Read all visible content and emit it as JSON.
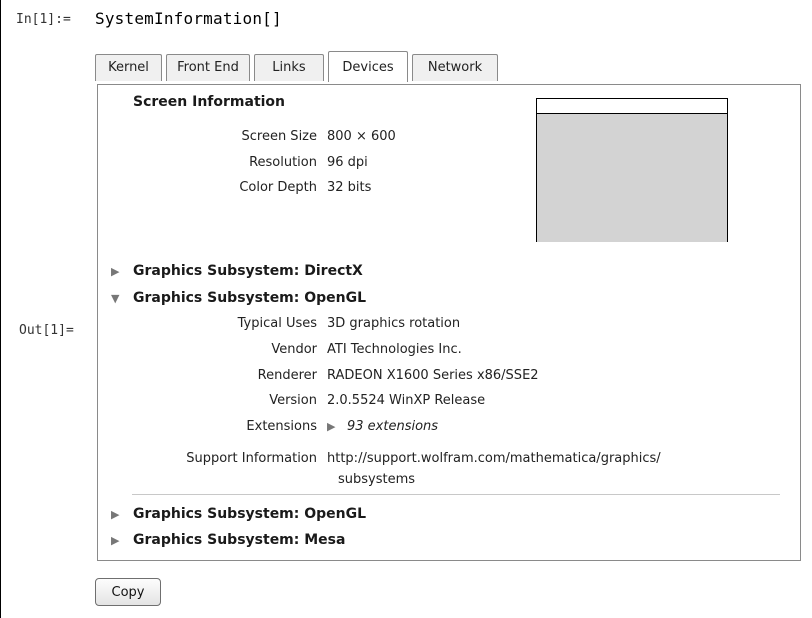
{
  "cell": {
    "in_label": "In[1]:=",
    "input": "SystemInformation[]",
    "out_label": "Out[1]="
  },
  "tabs": [
    {
      "label": "Kernel",
      "active": false
    },
    {
      "label": "Front End",
      "active": false
    },
    {
      "label": "Links",
      "active": false
    },
    {
      "label": "Devices",
      "active": true
    },
    {
      "label": "Network",
      "active": false
    }
  ],
  "screen": {
    "title": "Screen Information",
    "rows": [
      {
        "label": "Screen Size",
        "value": "800 × 600"
      },
      {
        "label": "Resolution",
        "value": "96 dpi"
      },
      {
        "label": "Color Depth",
        "value": "32 bits"
      }
    ]
  },
  "subsystems": {
    "directx": {
      "title": "Graphics Subsystem: DirectX",
      "expanded": false
    },
    "opengl": {
      "title": "Graphics Subsystem: OpenGL",
      "expanded": true,
      "rows": [
        {
          "label": "Typical Uses",
          "value": "3D graphics rotation"
        },
        {
          "label": "Vendor",
          "value": "ATI Technologies Inc."
        },
        {
          "label": "Renderer",
          "value": "RADEON X1600 Series x86/SSE2"
        },
        {
          "label": "Version",
          "value": "2.0.5524 WinXP Release"
        }
      ],
      "extensions_label": "Extensions",
      "extensions_value": "93 extensions",
      "support_label": "Support Information",
      "support_link_line1": "http://support.wolfram.com/mathematica/graphics/",
      "support_link_line2": "subsystems"
    },
    "opengl2": {
      "title": "Graphics Subsystem: OpenGL",
      "expanded": false
    },
    "mesa": {
      "title": "Graphics Subsystem: Mesa",
      "expanded": false
    }
  },
  "copy_button": "Copy",
  "icons": {
    "collapsed": "triangle-right-icon",
    "expanded": "triangle-down-icon"
  }
}
